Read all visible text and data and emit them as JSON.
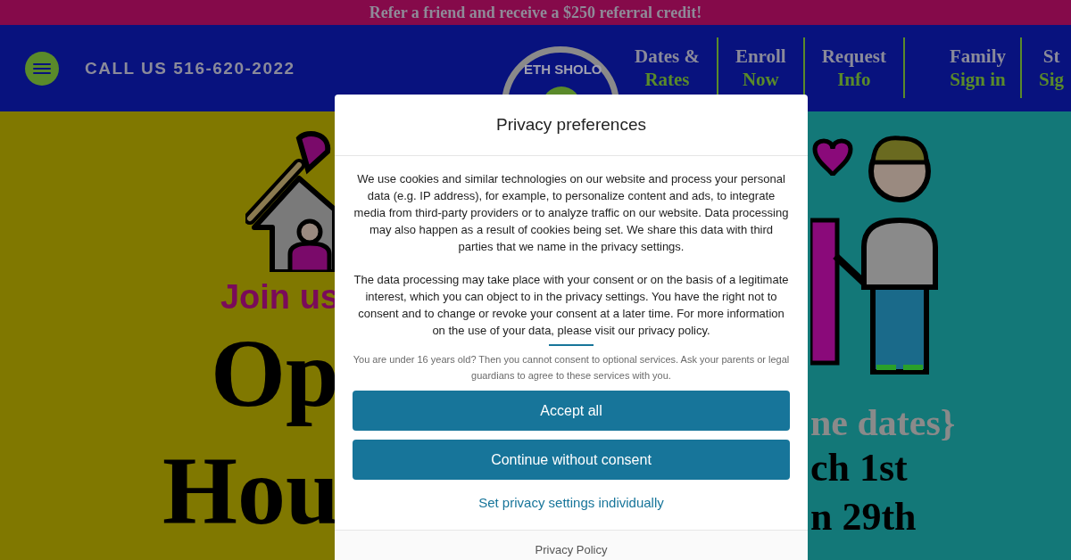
{
  "promo_bar": {
    "text": "Refer a friend and receive a $250 referral credit!"
  },
  "header": {
    "phone": "CALL US 516-620-2022",
    "logo_text": "ETH SHOLO",
    "nav": [
      {
        "top": "Dates &",
        "bottom": "Rates"
      },
      {
        "top": "Enroll",
        "bottom": "Now"
      },
      {
        "top": "Request",
        "bottom": "Info"
      },
      {
        "top": "Family",
        "bottom": "Sign in"
      },
      {
        "top": "St",
        "bottom": "Sig"
      }
    ]
  },
  "hero": {
    "left": {
      "tagline": "Join us",
      "title_lines": [
        "Op",
        "Hou"
      ]
    },
    "right": {
      "subtitle": "ne dates}",
      "dates": [
        "ch 1st",
        "n 29th"
      ]
    }
  },
  "consent_dialog": {
    "title": "Privacy preferences",
    "paragraphs": [
      "We use cookies and similar technologies on our website and process your personal data (e.g. IP address), for example, to personalize content and ads, to integrate media from third-party providers or to analyze traffic on our website. Data processing may also happen as a result of cookies being set. We share this data with third parties that we name in the privacy settings.",
      "The data processing may take place with your consent or on the basis of a legitimate interest, which you can object to in the privacy settings. You have the right not to consent and to change or revoke your consent at a later time. For more information on the use of your data, please visit our privacy policy."
    ],
    "age_notice": "You are under 16 years old? Then you cannot consent to optional services. Ask your parents or legal guardians to agree to these services with you.",
    "buttons": [
      {
        "label": "Accept all"
      },
      {
        "label": "Continue without consent"
      }
    ],
    "settings_link": "Set privacy settings individually",
    "footer_link": "Privacy Policy"
  }
}
